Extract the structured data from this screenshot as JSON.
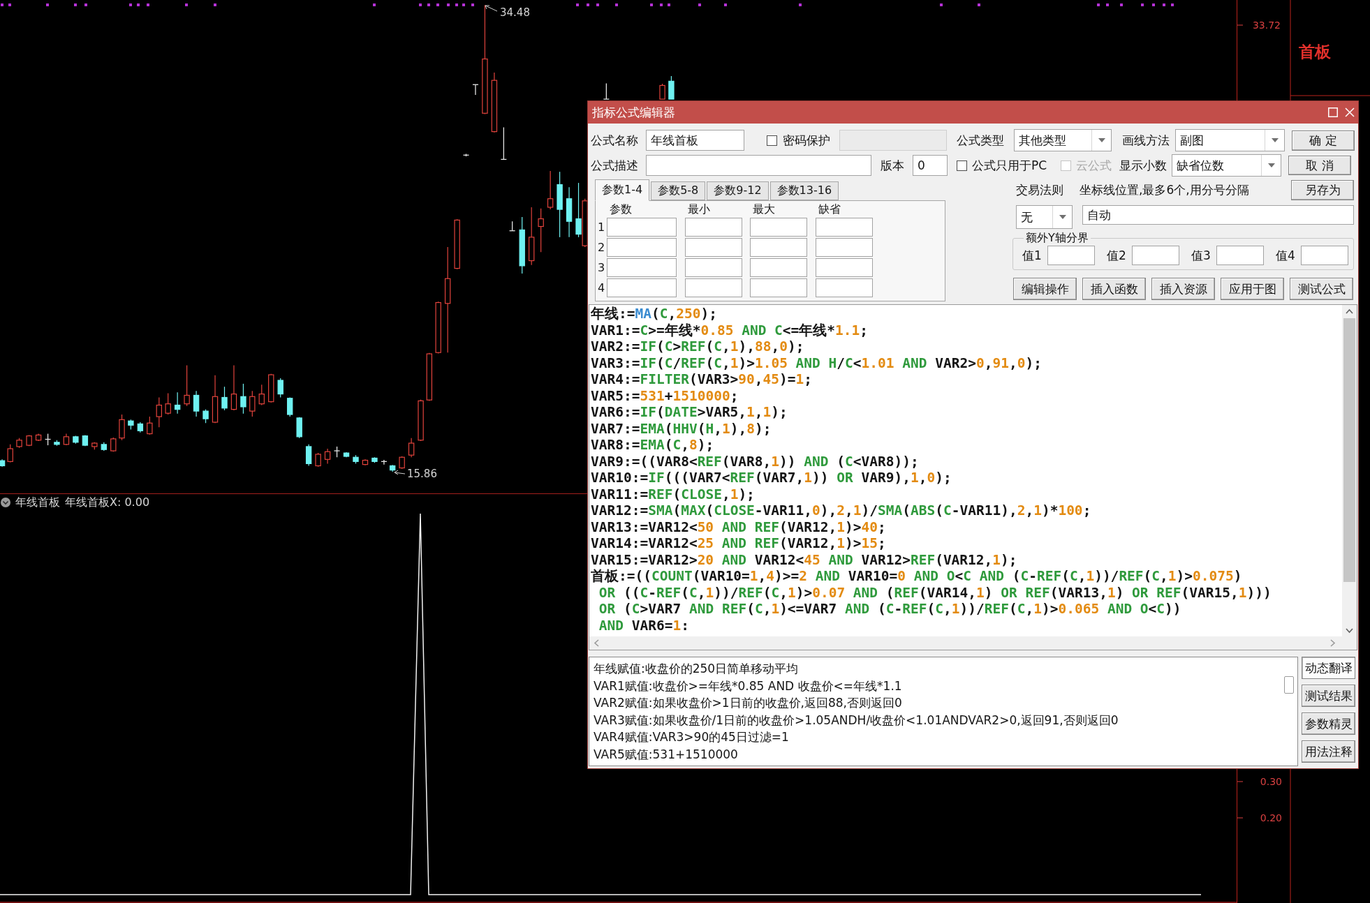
{
  "price_chart": {
    "high_label": "34.48",
    "low_label": "15.86"
  },
  "price_axis": {
    "title": "首板",
    "labels": [
      "33.72"
    ]
  },
  "indicator_panel": {
    "name": "年线首板",
    "value": "年线首板X: 0.00",
    "axis_labels": [
      "0.30",
      "0.20"
    ]
  },
  "dialog": {
    "title": "指标公式编辑器",
    "formula_name": {
      "label": "公式名称",
      "value": "年线首板"
    },
    "password": {
      "label": "密码保护",
      "checked": false
    },
    "formula_type": {
      "label": "公式类型",
      "value": "其他类型"
    },
    "draw_method": {
      "label": "画线方法",
      "value": "副图"
    },
    "description": {
      "label": "公式描述"
    },
    "version": {
      "label": "版本",
      "value": "0"
    },
    "pc_only": {
      "label": "公式只用于PC",
      "checked": false
    },
    "cloud": {
      "label": "云公式",
      "checked": false,
      "disabled": true
    },
    "decimals": {
      "label": "显示小数",
      "value": "缺省位数"
    },
    "side_buttons": [
      "确 定",
      "取 消",
      "另存为"
    ],
    "param_tabs": [
      {
        "label": "参数1-4",
        "selected": true
      },
      {
        "label": "参数5-8",
        "selected": false
      },
      {
        "label": "参数9-12",
        "selected": false
      },
      {
        "label": "参数13-16",
        "selected": false
      }
    ],
    "param_columns": [
      "参数",
      "最小",
      "最大",
      "缺省"
    ],
    "param_rows": [
      "1",
      "2",
      "3",
      "4"
    ],
    "trade_rule": {
      "label": "交易法则",
      "value": "无"
    },
    "axis_lines": {
      "label": "坐标线位置,最多6个,用分号分隔",
      "value": "自动"
    },
    "extra_y_axis": {
      "label": "额外Y轴分界",
      "values": [
        "值1",
        "值2",
        "值3",
        "值4"
      ]
    },
    "tool_buttons": [
      "编辑操作",
      "插入函数",
      "插入资源",
      "应用于图",
      "测试公式"
    ],
    "code_lines": [
      [
        {
          "kind": "text",
          "text": "年线:="
        },
        {
          "kind": "indicator",
          "text": "MA"
        },
        {
          "kind": "text",
          "text": "("
        },
        {
          "kind": "function",
          "text": "C"
        },
        {
          "kind": "text",
          "text": ","
        },
        {
          "kind": "number",
          "text": "250"
        },
        {
          "kind": "text",
          "text": ");"
        }
      ],
      [
        {
          "kind": "text",
          "text": "VAR1:="
        },
        {
          "kind": "function",
          "text": "C"
        },
        {
          "kind": "text",
          "text": ">=年线*"
        },
        {
          "kind": "number",
          "text": "0.85"
        },
        {
          "kind": "function",
          "text": " AND"
        },
        {
          "kind": "function",
          "text": " C"
        },
        {
          "kind": "text",
          "text": "<=年线*"
        },
        {
          "kind": "number",
          "text": "1.1"
        },
        {
          "kind": "text",
          "text": ";"
        }
      ],
      [
        {
          "kind": "text",
          "text": "VAR2:="
        },
        {
          "kind": "function",
          "text": "IF"
        },
        {
          "kind": "text",
          "text": "("
        },
        {
          "kind": "function",
          "text": "C"
        },
        {
          "kind": "text",
          "text": ">"
        },
        {
          "kind": "function",
          "text": "REF"
        },
        {
          "kind": "text",
          "text": "("
        },
        {
          "kind": "function",
          "text": "C"
        },
        {
          "kind": "text",
          "text": ","
        },
        {
          "kind": "number",
          "text": "1"
        },
        {
          "kind": "text",
          "text": "),"
        },
        {
          "kind": "number",
          "text": "88"
        },
        {
          "kind": "text",
          "text": ","
        },
        {
          "kind": "number",
          "text": "0"
        },
        {
          "kind": "text",
          "text": ");"
        }
      ],
      [
        {
          "kind": "text",
          "text": "VAR3:="
        },
        {
          "kind": "function",
          "text": "IF"
        },
        {
          "kind": "text",
          "text": "("
        },
        {
          "kind": "function",
          "text": "C"
        },
        {
          "kind": "text",
          "text": "/"
        },
        {
          "kind": "function",
          "text": "REF"
        },
        {
          "kind": "text",
          "text": "("
        },
        {
          "kind": "function",
          "text": "C"
        },
        {
          "kind": "text",
          "text": ","
        },
        {
          "kind": "number",
          "text": "1"
        },
        {
          "kind": "text",
          "text": ")>"
        },
        {
          "kind": "number",
          "text": "1.05"
        },
        {
          "kind": "function",
          "text": " AND"
        },
        {
          "kind": "function",
          "text": " H"
        },
        {
          "kind": "text",
          "text": "/"
        },
        {
          "kind": "function",
          "text": "C"
        },
        {
          "kind": "text",
          "text": "<"
        },
        {
          "kind": "number",
          "text": "1.01"
        },
        {
          "kind": "function",
          "text": " AND"
        },
        {
          "kind": "text",
          "text": " VAR2>"
        },
        {
          "kind": "number",
          "text": "0"
        },
        {
          "kind": "text",
          "text": ","
        },
        {
          "kind": "number",
          "text": "91"
        },
        {
          "kind": "text",
          "text": ","
        },
        {
          "kind": "number",
          "text": "0"
        },
        {
          "kind": "text",
          "text": ");"
        }
      ],
      [
        {
          "kind": "text",
          "text": "VAR4:="
        },
        {
          "kind": "function",
          "text": "FILTER"
        },
        {
          "kind": "text",
          "text": "(VAR3>"
        },
        {
          "kind": "number",
          "text": "90"
        },
        {
          "kind": "text",
          "text": ","
        },
        {
          "kind": "number",
          "text": "45"
        },
        {
          "kind": "text",
          "text": ")="
        },
        {
          "kind": "number",
          "text": "1"
        },
        {
          "kind": "text",
          "text": ";"
        }
      ],
      [
        {
          "kind": "text",
          "text": "VAR5:="
        },
        {
          "kind": "number",
          "text": "531"
        },
        {
          "kind": "text",
          "text": "+"
        },
        {
          "kind": "number",
          "text": "1510000"
        },
        {
          "kind": "text",
          "text": ";"
        }
      ],
      [
        {
          "kind": "text",
          "text": "VAR6:="
        },
        {
          "kind": "function",
          "text": "IF"
        },
        {
          "kind": "text",
          "text": "("
        },
        {
          "kind": "function",
          "text": "DATE"
        },
        {
          "kind": "text",
          "text": ">VAR5,"
        },
        {
          "kind": "number",
          "text": "1"
        },
        {
          "kind": "text",
          "text": ","
        },
        {
          "kind": "number",
          "text": "1"
        },
        {
          "kind": "text",
          "text": ");"
        }
      ],
      [
        {
          "kind": "text",
          "text": "VAR7:="
        },
        {
          "kind": "function",
          "text": "EMA"
        },
        {
          "kind": "text",
          "text": "("
        },
        {
          "kind": "function",
          "text": "HHV"
        },
        {
          "kind": "text",
          "text": "("
        },
        {
          "kind": "function",
          "text": "H"
        },
        {
          "kind": "text",
          "text": ","
        },
        {
          "kind": "number",
          "text": "1"
        },
        {
          "kind": "text",
          "text": "),"
        },
        {
          "kind": "number",
          "text": "8"
        },
        {
          "kind": "text",
          "text": ");"
        }
      ],
      [
        {
          "kind": "text",
          "text": "VAR8:="
        },
        {
          "kind": "function",
          "text": "EMA"
        },
        {
          "kind": "text",
          "text": "("
        },
        {
          "kind": "function",
          "text": "C"
        },
        {
          "kind": "text",
          "text": ","
        },
        {
          "kind": "number",
          "text": "8"
        },
        {
          "kind": "text",
          "text": ");"
        }
      ],
      [
        {
          "kind": "text",
          "text": "VAR9:=((VAR8<"
        },
        {
          "kind": "function",
          "text": "REF"
        },
        {
          "kind": "text",
          "text": "(VAR8,"
        },
        {
          "kind": "number",
          "text": "1"
        },
        {
          "kind": "text",
          "text": ")) "
        },
        {
          "kind": "function",
          "text": "AND"
        },
        {
          "kind": "text",
          "text": " ("
        },
        {
          "kind": "function",
          "text": "C"
        },
        {
          "kind": "text",
          "text": "<VAR8));"
        }
      ],
      [
        {
          "kind": "text",
          "text": "VAR10:="
        },
        {
          "kind": "function",
          "text": "IF"
        },
        {
          "kind": "text",
          "text": "(((VAR7<"
        },
        {
          "kind": "function",
          "text": "REF"
        },
        {
          "kind": "text",
          "text": "(VAR7,"
        },
        {
          "kind": "number",
          "text": "1"
        },
        {
          "kind": "text",
          "text": ")) "
        },
        {
          "kind": "function",
          "text": "OR"
        },
        {
          "kind": "text",
          "text": " VAR9),"
        },
        {
          "kind": "number",
          "text": "1"
        },
        {
          "kind": "text",
          "text": ","
        },
        {
          "kind": "number",
          "text": "0"
        },
        {
          "kind": "text",
          "text": ");"
        }
      ],
      [
        {
          "kind": "text",
          "text": "VAR11:="
        },
        {
          "kind": "function",
          "text": "REF"
        },
        {
          "kind": "text",
          "text": "("
        },
        {
          "kind": "function",
          "text": "CLOSE"
        },
        {
          "kind": "text",
          "text": ","
        },
        {
          "kind": "number",
          "text": "1"
        },
        {
          "kind": "text",
          "text": ");"
        }
      ],
      [
        {
          "kind": "text",
          "text": "VAR12:="
        },
        {
          "kind": "function",
          "text": "SMA"
        },
        {
          "kind": "text",
          "text": "("
        },
        {
          "kind": "function",
          "text": "MAX"
        },
        {
          "kind": "text",
          "text": "("
        },
        {
          "kind": "function",
          "text": "CLOSE"
        },
        {
          "kind": "text",
          "text": "-VAR11,"
        },
        {
          "kind": "number",
          "text": "0"
        },
        {
          "kind": "text",
          "text": "),"
        },
        {
          "kind": "number",
          "text": "2"
        },
        {
          "kind": "text",
          "text": ","
        },
        {
          "kind": "number",
          "text": "1"
        },
        {
          "kind": "text",
          "text": ")/"
        },
        {
          "kind": "function",
          "text": "SMA"
        },
        {
          "kind": "text",
          "text": "("
        },
        {
          "kind": "function",
          "text": "ABS"
        },
        {
          "kind": "text",
          "text": "("
        },
        {
          "kind": "function",
          "text": "C"
        },
        {
          "kind": "text",
          "text": "-VAR11),"
        },
        {
          "kind": "number",
          "text": "2"
        },
        {
          "kind": "text",
          "text": ","
        },
        {
          "kind": "number",
          "text": "1"
        },
        {
          "kind": "text",
          "text": ")*"
        },
        {
          "kind": "number",
          "text": "100"
        },
        {
          "kind": "text",
          "text": ";"
        }
      ],
      [
        {
          "kind": "text",
          "text": "VAR13:=VAR12<"
        },
        {
          "kind": "number",
          "text": "50"
        },
        {
          "kind": "function",
          "text": " AND"
        },
        {
          "kind": "function",
          "text": " REF"
        },
        {
          "kind": "text",
          "text": "(VAR12,"
        },
        {
          "kind": "number",
          "text": "1"
        },
        {
          "kind": "text",
          "text": ")>"
        },
        {
          "kind": "number",
          "text": "40"
        },
        {
          "kind": "text",
          "text": ";"
        }
      ],
      [
        {
          "kind": "text",
          "text": "VAR14:=VAR12<"
        },
        {
          "kind": "number",
          "text": "25"
        },
        {
          "kind": "function",
          "text": " AND"
        },
        {
          "kind": "function",
          "text": " REF"
        },
        {
          "kind": "text",
          "text": "(VAR12,"
        },
        {
          "kind": "number",
          "text": "1"
        },
        {
          "kind": "text",
          "text": ")>"
        },
        {
          "kind": "number",
          "text": "15"
        },
        {
          "kind": "text",
          "text": ";"
        }
      ],
      [
        {
          "kind": "text",
          "text": "VAR15:=VAR12>"
        },
        {
          "kind": "number",
          "text": "20"
        },
        {
          "kind": "function",
          "text": " AND"
        },
        {
          "kind": "text",
          "text": " VAR12<"
        },
        {
          "kind": "number",
          "text": "45"
        },
        {
          "kind": "function",
          "text": " AND"
        },
        {
          "kind": "text",
          "text": " VAR12>"
        },
        {
          "kind": "function",
          "text": "REF"
        },
        {
          "kind": "text",
          "text": "(VAR12,"
        },
        {
          "kind": "number",
          "text": "1"
        },
        {
          "kind": "text",
          "text": ");"
        }
      ],
      [
        {
          "kind": "text",
          "text": "首板:=(("
        },
        {
          "kind": "function",
          "text": "COUNT"
        },
        {
          "kind": "text",
          "text": "(VAR10="
        },
        {
          "kind": "number",
          "text": "1"
        },
        {
          "kind": "text",
          "text": ","
        },
        {
          "kind": "number",
          "text": "4"
        },
        {
          "kind": "text",
          "text": ")>="
        },
        {
          "kind": "number",
          "text": "2"
        },
        {
          "kind": "function",
          "text": " AND"
        },
        {
          "kind": "text",
          "text": " VAR10="
        },
        {
          "kind": "number",
          "text": "0"
        },
        {
          "kind": "function",
          "text": " AND"
        },
        {
          "kind": "function",
          "text": " O"
        },
        {
          "kind": "text",
          "text": "<"
        },
        {
          "kind": "function",
          "text": "C"
        },
        {
          "kind": "function",
          "text": " AND"
        },
        {
          "kind": "text",
          "text": " ("
        },
        {
          "kind": "function",
          "text": "C"
        },
        {
          "kind": "text",
          "text": "-"
        },
        {
          "kind": "function",
          "text": "REF"
        },
        {
          "kind": "text",
          "text": "("
        },
        {
          "kind": "function",
          "text": "C"
        },
        {
          "kind": "text",
          "text": ","
        },
        {
          "kind": "number",
          "text": "1"
        },
        {
          "kind": "text",
          "text": "))/"
        },
        {
          "kind": "function",
          "text": "REF"
        },
        {
          "kind": "text",
          "text": "("
        },
        {
          "kind": "function",
          "text": "C"
        },
        {
          "kind": "text",
          "text": ","
        },
        {
          "kind": "number",
          "text": "1"
        },
        {
          "kind": "text",
          "text": ")>"
        },
        {
          "kind": "number",
          "text": "0.075"
        },
        {
          "kind": "text",
          "text": ")"
        }
      ],
      [
        {
          "kind": "function",
          "text": " OR"
        },
        {
          "kind": "text",
          "text": " (("
        },
        {
          "kind": "function",
          "text": "C"
        },
        {
          "kind": "text",
          "text": "-"
        },
        {
          "kind": "function",
          "text": "REF"
        },
        {
          "kind": "text",
          "text": "("
        },
        {
          "kind": "function",
          "text": "C"
        },
        {
          "kind": "text",
          "text": ","
        },
        {
          "kind": "number",
          "text": "1"
        },
        {
          "kind": "text",
          "text": "))/"
        },
        {
          "kind": "function",
          "text": "REF"
        },
        {
          "kind": "text",
          "text": "("
        },
        {
          "kind": "function",
          "text": "C"
        },
        {
          "kind": "text",
          "text": ","
        },
        {
          "kind": "number",
          "text": "1"
        },
        {
          "kind": "text",
          "text": ")>"
        },
        {
          "kind": "number",
          "text": "0.07"
        },
        {
          "kind": "function",
          "text": " AND"
        },
        {
          "kind": "text",
          "text": " ("
        },
        {
          "kind": "function",
          "text": "REF"
        },
        {
          "kind": "text",
          "text": "(VAR14,"
        },
        {
          "kind": "number",
          "text": "1"
        },
        {
          "kind": "text",
          "text": ") "
        },
        {
          "kind": "function",
          "text": "OR"
        },
        {
          "kind": "function",
          "text": " REF"
        },
        {
          "kind": "text",
          "text": "(VAR13,"
        },
        {
          "kind": "number",
          "text": "1"
        },
        {
          "kind": "text",
          "text": ") "
        },
        {
          "kind": "function",
          "text": "OR"
        },
        {
          "kind": "function",
          "text": " REF"
        },
        {
          "kind": "text",
          "text": "(VAR15,"
        },
        {
          "kind": "number",
          "text": "1"
        },
        {
          "kind": "text",
          "text": ")))"
        }
      ],
      [
        {
          "kind": "function",
          "text": " OR"
        },
        {
          "kind": "text",
          "text": " ("
        },
        {
          "kind": "function",
          "text": "C"
        },
        {
          "kind": "text",
          "text": ">VAR7 "
        },
        {
          "kind": "function",
          "text": "AND"
        },
        {
          "kind": "function",
          "text": " REF"
        },
        {
          "kind": "text",
          "text": "("
        },
        {
          "kind": "function",
          "text": "C"
        },
        {
          "kind": "text",
          "text": ","
        },
        {
          "kind": "number",
          "text": "1"
        },
        {
          "kind": "text",
          "text": ")<=VAR7 "
        },
        {
          "kind": "function",
          "text": "AND"
        },
        {
          "kind": "text",
          "text": " ("
        },
        {
          "kind": "function",
          "text": "C"
        },
        {
          "kind": "text",
          "text": "-"
        },
        {
          "kind": "function",
          "text": "REF"
        },
        {
          "kind": "text",
          "text": "("
        },
        {
          "kind": "function",
          "text": "C"
        },
        {
          "kind": "text",
          "text": ","
        },
        {
          "kind": "number",
          "text": "1"
        },
        {
          "kind": "text",
          "text": "))/"
        },
        {
          "kind": "function",
          "text": "REF"
        },
        {
          "kind": "text",
          "text": "("
        },
        {
          "kind": "function",
          "text": "C"
        },
        {
          "kind": "text",
          "text": ","
        },
        {
          "kind": "number",
          "text": "1"
        },
        {
          "kind": "text",
          "text": ")>"
        },
        {
          "kind": "number",
          "text": "0.065"
        },
        {
          "kind": "function",
          "text": " AND"
        },
        {
          "kind": "function",
          "text": " O"
        },
        {
          "kind": "text",
          "text": "<"
        },
        {
          "kind": "function",
          "text": "C"
        },
        {
          "kind": "text",
          "text": "))"
        }
      ],
      [
        {
          "kind": "function",
          "text": " AND"
        },
        {
          "kind": "text",
          "text": " VAR6="
        },
        {
          "kind": "number",
          "text": "1"
        },
        {
          "kind": "text",
          "text": ":"
        }
      ]
    ],
    "translation_lines": [
      "年线赋值:收盘价的250日简单移动平均",
      "VAR1赋值:收盘价>=年线*0.85 AND 收盘价<=年线*1.1",
      "VAR2赋值:如果收盘价>1日前的收盘价,返回88,否则返回0",
      "VAR3赋值:如果收盘价/1日前的收盘价>1.05ANDH/收盘价<1.01ANDVAR2>0,返回91,否则返回0",
      "VAR4赋值:VAR3>90的45日过滤=1",
      "VAR5赋值:531+1510000"
    ],
    "help_buttons": [
      {
        "label": "动态翻译",
        "pressed": true
      },
      {
        "label": "测试结果",
        "pressed": false
      },
      {
        "label": "参数精灵",
        "pressed": false
      },
      {
        "label": "用法注释",
        "pressed": false
      }
    ]
  }
}
